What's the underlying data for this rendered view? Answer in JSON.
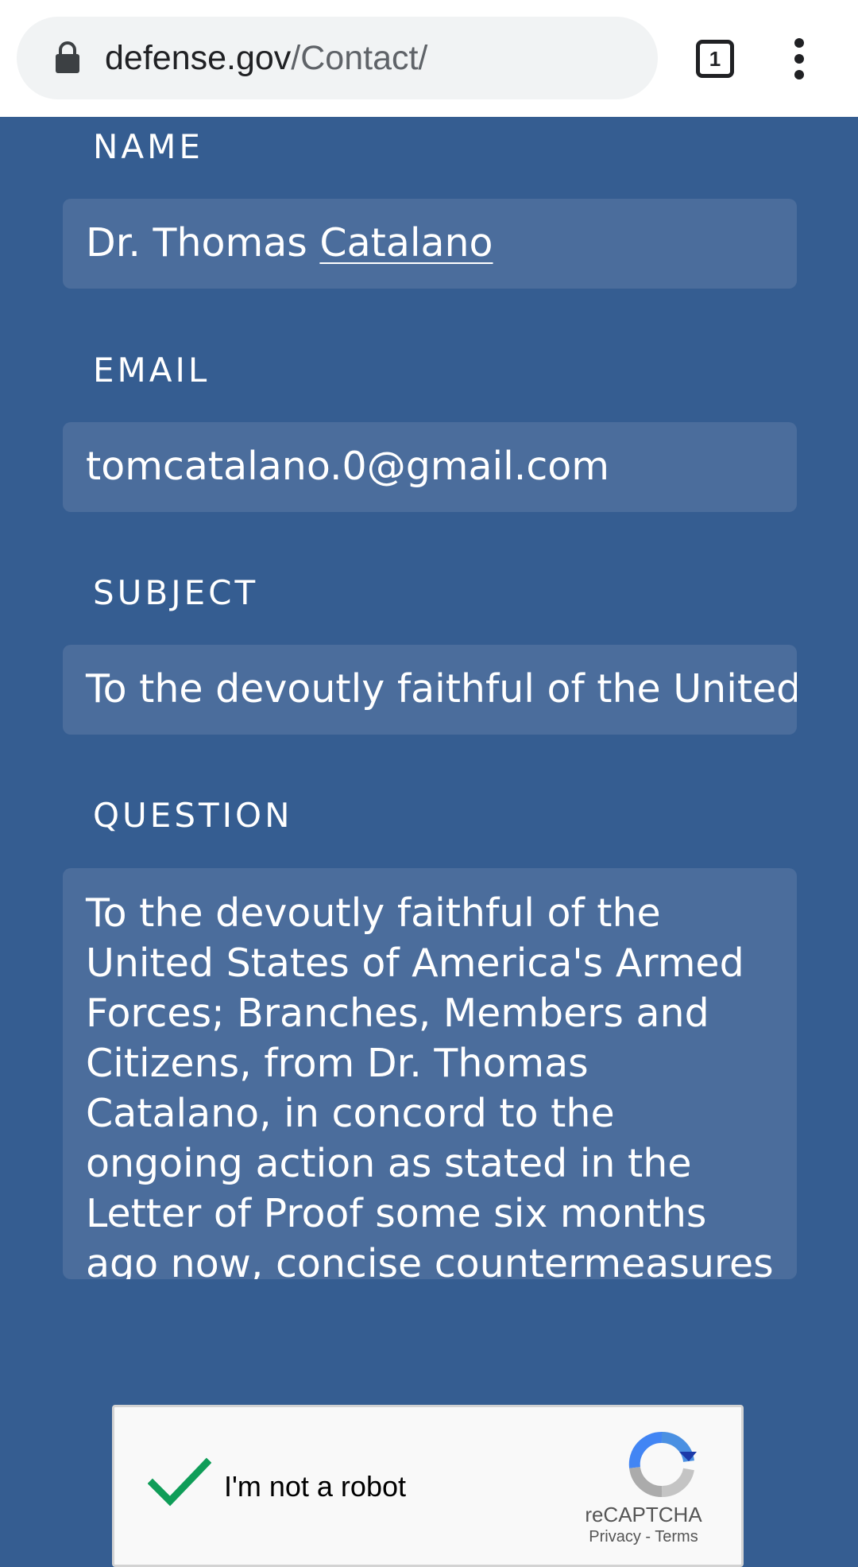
{
  "browser": {
    "url_domain": "defense.gov",
    "url_path": "/Contact/",
    "tab_count": "1"
  },
  "form": {
    "name_label": "NAME",
    "name_value_first": "Dr. Thomas ",
    "name_value_last": "Catalano",
    "email_label": "EMAIL",
    "email_value": "tomcatalano.0@gmail.com",
    "subject_label": "SUBJECT",
    "subject_value": "To the  devoutly faithful of the United",
    "question_label": "QUESTION",
    "question_value": "To the  devoutly faithful of the United States of America's Armed Forces; Branches, Members and Citizens, from Dr. Thomas Catalano, in concord to the ongoing action as stated in the Letter of Proof some six months ago now, concise countermeasures for resilience to forgo forcible atrocities"
  },
  "captcha": {
    "label": "I'm not a robot",
    "brand": "reCAPTCHA",
    "links": "Privacy - Terms",
    "checked": true
  },
  "colors": {
    "page_bg": "#355d91",
    "field_bg": "#4b6d9c",
    "check_green": "#0f9d58"
  }
}
